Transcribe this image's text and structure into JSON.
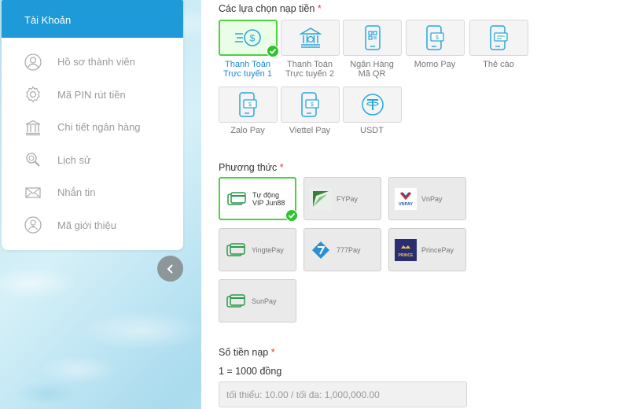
{
  "sidebar": {
    "header": "Tài Khoản",
    "items": [
      {
        "label": "Hồ sơ thành viên",
        "icon": "user-icon"
      },
      {
        "label": "Mã PIN rút tiền",
        "icon": "gear-icon"
      },
      {
        "label": "Chi tiết ngân hàng",
        "icon": "bank-icon"
      },
      {
        "label": "Lịch sử",
        "icon": "search-history-icon"
      },
      {
        "label": "Nhắn tin",
        "icon": "envelope-icon"
      },
      {
        "label": "Mã giới thiệu",
        "icon": "referral-icon"
      }
    ]
  },
  "deposit_options": {
    "title": "Các lựa chọn nạp tiền",
    "required_mark": "*",
    "options": [
      {
        "line1": "Thanh Toán",
        "line2": "Trực tuyến 1",
        "icon": "online-payment-icon",
        "selected": true
      },
      {
        "line1": "Thanh Toán",
        "line2": "Trực tuyến 2",
        "icon": "bank-building-icon",
        "selected": false
      },
      {
        "line1": "Ngân Hàng",
        "line2": "Mã QR",
        "icon": "phone-qr-icon",
        "selected": false
      },
      {
        "line1": "Momo Pay",
        "line2": "",
        "icon": "phone-card-icon",
        "selected": false
      },
      {
        "line1": "Thẻ cào",
        "line2": "",
        "icon": "scratch-card-icon",
        "selected": false
      },
      {
        "line1": "Zalo Pay",
        "line2": "",
        "icon": "phone-card-icon",
        "selected": false
      },
      {
        "line1": "Viettel Pay",
        "line2": "",
        "icon": "phone-card-icon",
        "selected": false
      },
      {
        "line1": "USDT",
        "line2": "",
        "icon": "tether-icon",
        "selected": false
      }
    ]
  },
  "methods": {
    "title": "Phương thức",
    "required_mark": "*",
    "items": [
      {
        "line1": "Tự động",
        "line2": "VIP Jun88",
        "logo": "card-icon",
        "selected": true
      },
      {
        "line1": "FYPay",
        "line2": "",
        "logo": "fypay-logo",
        "selected": false
      },
      {
        "line1": "VnPay",
        "line2": "",
        "logo": "vnpay-logo",
        "selected": false
      },
      {
        "line1": "YingtePay",
        "line2": "",
        "logo": "card-icon",
        "selected": false
      },
      {
        "line1": "777Pay",
        "line2": "",
        "logo": "777pay-logo",
        "selected": false
      },
      {
        "line1": "PrincePay",
        "line2": "",
        "logo": "prince-logo",
        "selected": false
      },
      {
        "line1": "SunPay",
        "line2": "",
        "logo": "card-icon",
        "selected": false
      }
    ]
  },
  "amount": {
    "title": "Số tiền nạp",
    "required_mark": "*",
    "rate": "1 = 1000 đồng",
    "placeholder": "tối thiểu: 10.00 / tối đa: 1,000,000.00"
  },
  "vnpay_logo_text": "VNPAY",
  "prince_logo_text": "PRINCE",
  "colors": {
    "accent_blue": "#1f9ad8",
    "selected_green": "#4cd23c",
    "required_red": "#e53935",
    "link_blue": "#1a8ad0"
  }
}
